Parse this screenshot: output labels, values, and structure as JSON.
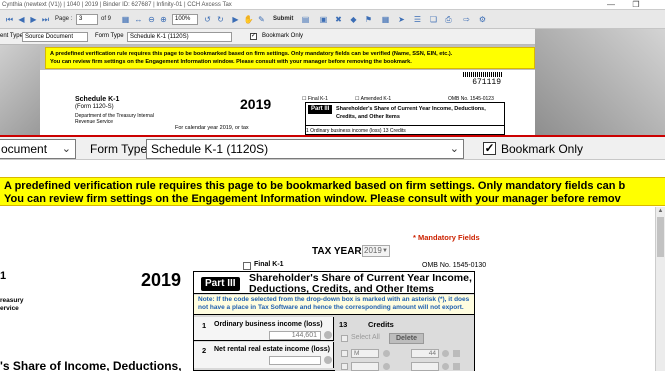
{
  "window": {
    "title": "Cynthia (newtext (V1)) | 1040 | 2019 | Binder ID: 627687 | Infinity-01 | CCH Axcess Tax",
    "minimize_icon": "minimize-icon",
    "restore_icon": "restore-icon"
  },
  "toolbar": {
    "page_label": "Page :",
    "page_value": "3",
    "page_total": "of 9",
    "zoom_value": "100%",
    "submit_label": "Submit"
  },
  "doc_toolbar": {
    "source_value": "Source Document",
    "source_value_zoomed": "ocument",
    "form_type_label": "Form Type",
    "form_type_value": "Schedule K-1 (1120S)",
    "bookmark_checked": true,
    "bookmark_label": "Bookmark Only",
    "type_label": "ent Type"
  },
  "banner": {
    "line1": "A predefined verification rule requires this page to be bookmarked based on firm settings. Only mandatory fields can be verified (Name, SSN, EIN, etc.).",
    "line2": "You can review firm settings on the Engagement Information window. Please consult with your manager before removing the bookmark.",
    "zoom_line1": "A predefined verification rule requires this page to be bookmarked based on firm settings. Only mandatory fields can b",
    "zoom_line2": "You can review firm settings on the Engagement Information window. Please consult with your manager before remov"
  },
  "source_page": {
    "doc_number": "671119",
    "schedule": "Schedule K-1",
    "form": "(Form 1120-S)",
    "department": "Department of the Treasury Internal Revenue Service",
    "calendar": "For calendar year 2019, or tax",
    "year": "2019",
    "final_k1": "Final K-1",
    "amended_k1": "Amended K-1",
    "omb": "OMB No. 1545-0123",
    "part": "Part III",
    "part_title": "Shareholder's Share of Current Year Income, Deductions, Credits, and Other Items",
    "row1": "1   Ordinary business income (loss)      13   Credits"
  },
  "form": {
    "mandatory_label": "* Mandatory Fields",
    "tax_year_label": "TAX YEAR",
    "tax_year_value": "2019",
    "final_k1_label": "Final K-1",
    "omb": "OMB No. 1545-0130",
    "left_1": "1",
    "left_treasury": "reasury",
    "left_service": "ervice",
    "left_bottom": "'s Share of Income, Deductions,",
    "year": "2019",
    "part_badge": "Part III",
    "part_title": "Shareholder's Share of Current Year Income, Deductions, Credits, and Other Items",
    "note": "Note: If the code selected from the drop-down box is marked with an asterisk (*), it does not have a place in Tax Software and hence the corresponding amount will not export.",
    "row1_num": "1",
    "row1_label": "Ordinary business income (loss)",
    "row1_value": "144,601",
    "row2_num": "2",
    "row2_label": "Net rental real estate income (loss)",
    "credits_num": "13",
    "credits_label": "Credits",
    "select_all": "Select All",
    "delete_label": "Delete",
    "credit_code_1": "M",
    "credit_amount_1": "44",
    "credit_code_2": "",
    "credit_amount_2": ""
  }
}
